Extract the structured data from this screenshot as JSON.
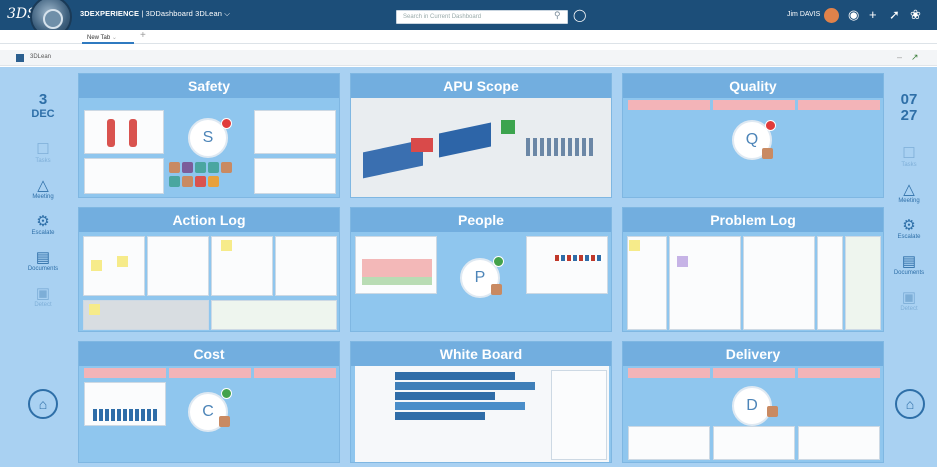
{
  "app": {
    "brand": "3DS",
    "title_bold": "3DEXPERIENCE",
    "title_rest": " | 3DDashboard 3DLean",
    "user": "Jim DAVIS",
    "search_placeholder": "Search in Current Dashboard"
  },
  "tabs": [
    {
      "label": "New Tab"
    }
  ],
  "subbar": {
    "label": "3DLean"
  },
  "left_panel": {
    "day": "3",
    "month": "DEC",
    "items": [
      {
        "label": "Tasks",
        "icon": "task-icon",
        "dim": true
      },
      {
        "label": "Meeting",
        "icon": "meeting-icon"
      },
      {
        "label": "Escalate",
        "icon": "escalate-icon"
      },
      {
        "label": "Documents",
        "icon": "document-icon"
      },
      {
        "label": "Detect",
        "icon": "detect-icon",
        "dim": true
      }
    ]
  },
  "right_panel": {
    "month": "07",
    "day": "27",
    "items": [
      {
        "label": "Tasks",
        "icon": "task-icon",
        "dim": true
      },
      {
        "label": "Meeting",
        "icon": "meeting-icon"
      },
      {
        "label": "Escalate",
        "icon": "escalate-icon"
      },
      {
        "label": "Documents",
        "icon": "document-icon"
      },
      {
        "label": "Detect",
        "icon": "detect-icon",
        "dim": true
      }
    ]
  },
  "tiles": [
    {
      "id": "safety",
      "title": "Safety",
      "avatar_letter": "S"
    },
    {
      "id": "apu-scope",
      "title": "APU Scope"
    },
    {
      "id": "quality",
      "title": "Quality",
      "avatar_letter": "Q"
    },
    {
      "id": "action-log",
      "title": "Action Log"
    },
    {
      "id": "people",
      "title": "People",
      "avatar_letter": "P"
    },
    {
      "id": "problem-log",
      "title": "Problem Log"
    },
    {
      "id": "cost",
      "title": "Cost",
      "avatar_letter": "C"
    },
    {
      "id": "white-board",
      "title": "White Board"
    },
    {
      "id": "delivery",
      "title": "Delivery",
      "avatar_letter": "D"
    }
  ],
  "colors": {
    "topbar": "#1c4e79",
    "background": "#a9d1f2",
    "tile_header": "#72aedf",
    "accent": "#2e6fa8"
  }
}
